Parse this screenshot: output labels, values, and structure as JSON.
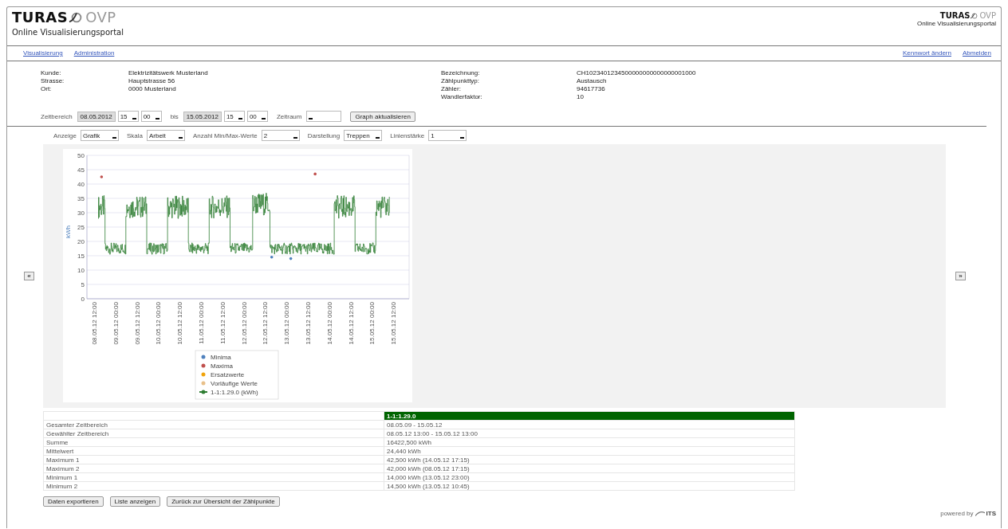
{
  "header": {
    "logo_left": "TURAS",
    "logo_right": "OVP",
    "subtitle": "Online Visualisierungsportal",
    "small_logo_left": "TURAS",
    "small_logo_right": "OVP",
    "small_subtitle": "Online Visualisierungsportal"
  },
  "nav": {
    "left": [
      {
        "label": "Visualisierung"
      },
      {
        "label": "Administration"
      }
    ],
    "right": [
      {
        "label": "Kennwort ändern"
      },
      {
        "label": "Abmelden"
      }
    ]
  },
  "info_left": [
    {
      "label": "Kunde:",
      "value": "Elektrizitätswerk Musterland"
    },
    {
      "label": "Strasse:",
      "value": "Hauptstrasse 56"
    },
    {
      "label": "Ort:",
      "value": "0000   Musterland"
    }
  ],
  "info_right": [
    {
      "label": "Bezeichnung:",
      "value": "CH1023401234500000000000000001000"
    },
    {
      "label": "Zählpunkttyp:",
      "value": "Austausch"
    },
    {
      "label": "Zähler:",
      "value": "94617736"
    },
    {
      "label": "Wandlerfaktor:",
      "value": "10"
    }
  ],
  "range": {
    "label": "Zeitbereich",
    "from_date": "08.05.2012",
    "from_hour": "15",
    "from_minute": "00",
    "to_label": "bis",
    "to_date": "15.05.2012",
    "to_hour": "15",
    "to_minute": "00",
    "period_label": "Zeitraum",
    "update_button": "Graph aktualisieren"
  },
  "options": [
    {
      "label": "Anzeige",
      "value": "Grafik"
    },
    {
      "label": "Skala",
      "value": "Arbeit"
    },
    {
      "label": "Anzahl Min/Max-Werte",
      "value": "2"
    },
    {
      "label": "Darstellung",
      "value": "Treppen"
    },
    {
      "label": "Linienstärke",
      "value": "1"
    }
  ],
  "pager": {
    "prev": "«",
    "next": "»"
  },
  "chart": {
    "ylabel": "kWh",
    "yticks": [
      "50",
      "45",
      "40",
      "35",
      "30",
      "25",
      "20",
      "15",
      "10",
      "5",
      "0"
    ],
    "xlabels": [
      "08.05.12 12:00",
      "09.05.12 00:00",
      "09.05.12 12:00",
      "10.05.12 00:00",
      "10.05.12 12:00",
      "11.05.12 00:00",
      "11.05.12 12:00",
      "12.05.12 00:00",
      "12.05.12 12:00",
      "13.05.12 00:00",
      "13.05.12 12:00",
      "14.05.12 00:00",
      "14.05.12 12:00",
      "15.05.12 00:00",
      "15.05.12 12:00"
    ],
    "legend": [
      {
        "label": "Minima",
        "color": "#4f81bd",
        "kind": "dot"
      },
      {
        "label": "Maxima",
        "color": "#c0504d",
        "kind": "dot"
      },
      {
        "label": "Ersatzwerte",
        "color": "#f0a30a",
        "kind": "dot"
      },
      {
        "label": "Vorläufige Werte",
        "color": "#e8c08a",
        "kind": "dot"
      },
      {
        "label": "1-1:1.29.0 (kWh)",
        "color": "#2e7d32",
        "kind": "line"
      }
    ]
  },
  "summary": {
    "column": "1-1:1.29.0",
    "rows": [
      {
        "label": "Gesamter Zeitbereich",
        "value": "08.05.09 - 15.05.12"
      },
      {
        "label": "Gewählter Zeitbereich",
        "value": "08.05.12 13:00 - 15.05.12 13:00"
      },
      {
        "label": "Summe",
        "value": "16422,500 kWh"
      },
      {
        "label": "Mittelwert",
        "value": "24,440 kWh"
      },
      {
        "label": "Maximum 1",
        "value": "42,500 kWh (14.05.12 17:15)"
      },
      {
        "label": "Maximum 2",
        "value": "42,000 kWh (08.05.12 17:15)"
      },
      {
        "label": "Minimum 1",
        "value": "14,000 kWh (13.05.12 23:00)"
      },
      {
        "label": "Minimum 2",
        "value": "14,500 kWh (13.05.12 10:45)"
      }
    ]
  },
  "buttons": [
    "Daten exportieren",
    "Liste anzeigen",
    "Zurück zur Übersicht der Zählpunkte"
  ],
  "footer": {
    "text": "powered by",
    "brand": "ITS"
  }
}
